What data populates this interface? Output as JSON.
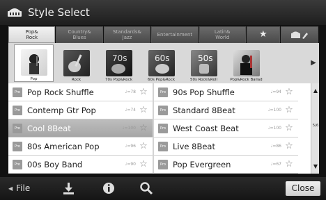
{
  "title": "Style Select",
  "category_tabs": [
    {
      "line1": "Pop&",
      "line2": "Rock",
      "active": true
    },
    {
      "line1": "Country&",
      "line2": "Blues",
      "active": false
    },
    {
      "line1": "Standards&",
      "line2": "Jazz",
      "active": false
    },
    {
      "line1": "Entertainment",
      "line2": "",
      "active": false
    },
    {
      "line1": "Latin&",
      "line2": "World",
      "active": false
    }
  ],
  "favorite_tab_icon": "star-icon",
  "tools_tab_icon": "piano-edit-icon",
  "subcategories": [
    {
      "label": "Pop",
      "icon": "pop-thumb",
      "active": true
    },
    {
      "label": "Rock",
      "icon": "rock-guitar-thumb",
      "active": false
    },
    {
      "label": "70s Pop&Rock",
      "icon": "70s-thumb",
      "active": false
    },
    {
      "label": "60s Pop&Rock",
      "icon": "60s-thumb",
      "active": false
    },
    {
      "label": "50s Rock&Roll",
      "icon": "50s-thumb",
      "active": false
    },
    {
      "label": "Pop&Rock Ballad",
      "icon": "ballad-thumb",
      "active": false
    }
  ],
  "styles_left": [
    {
      "name": "Pop Rock Shuffle",
      "tempo": "♩=78",
      "selected": false
    },
    {
      "name": "Contemp Gtr Pop",
      "tempo": "♩=74",
      "selected": false
    },
    {
      "name": "Cool 8Beat",
      "tempo": "♩=100",
      "selected": true
    },
    {
      "name": "80s American Pop",
      "tempo": "♩=96",
      "selected": false
    },
    {
      "name": "00s Boy Band",
      "tempo": "♩=90",
      "selected": false
    }
  ],
  "styles_right": [
    {
      "name": "90s Pop Shuffle",
      "tempo": "♩=94",
      "selected": false
    },
    {
      "name": "Standard 8Beat",
      "tempo": "♩=100",
      "selected": false
    },
    {
      "name": "West Coast Beat",
      "tempo": "♩=100",
      "selected": false
    },
    {
      "name": "Live 8Beat",
      "tempo": "♩=86",
      "selected": false
    },
    {
      "name": "Pop Evergreen",
      "tempo": "♩=67",
      "selected": false
    }
  ],
  "pro_badge": "Pro",
  "page_indicator": "5/6",
  "file_label": "File",
  "close_label": "Close"
}
